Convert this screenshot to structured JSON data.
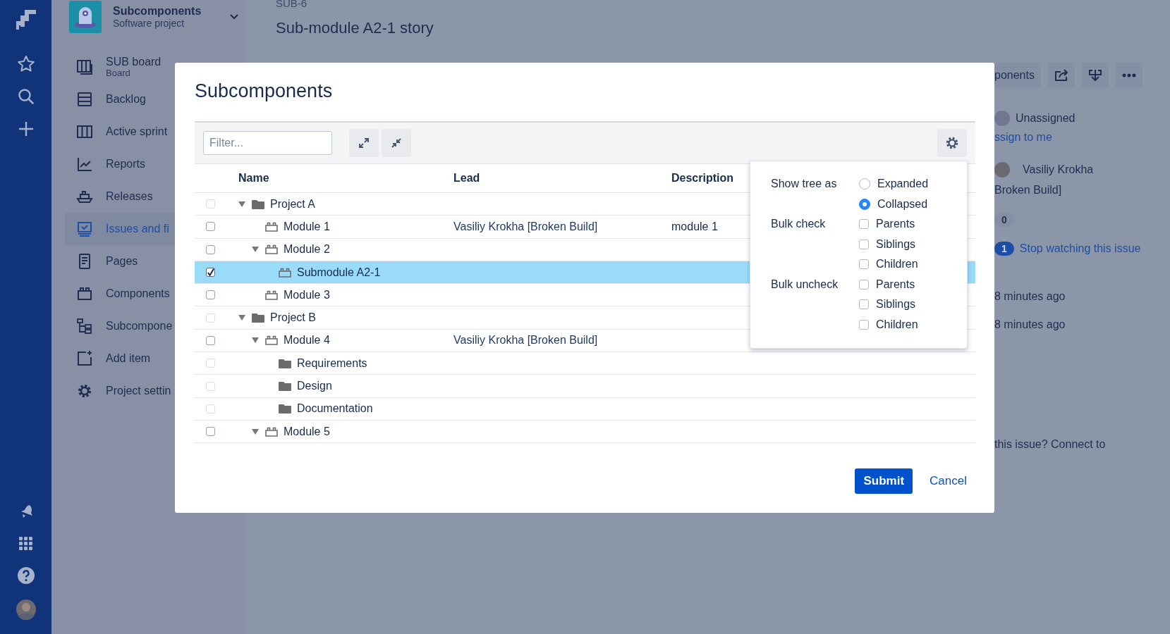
{
  "project": {
    "name": "Subcomponents",
    "type": "Software project"
  },
  "sidebar": {
    "items": [
      {
        "label": "SUB board",
        "sublabel": "Board",
        "kind": "board",
        "selected": false
      },
      {
        "label": "Backlog",
        "kind": "backlog",
        "selected": false
      },
      {
        "label": "Active sprint",
        "kind": "sprints",
        "selected": false
      },
      {
        "label": "Reports",
        "kind": "reports",
        "selected": false
      },
      {
        "label": "Releases",
        "kind": "releases",
        "selected": false
      },
      {
        "label": "Issues and fi",
        "kind": "issues",
        "selected": true
      },
      {
        "label": "Pages",
        "kind": "pages",
        "selected": false
      },
      {
        "label": "Components",
        "kind": "components",
        "selected": false
      },
      {
        "label": "Subcompone",
        "kind": "subcomponents",
        "selected": false
      },
      {
        "label": "Add item",
        "kind": "add",
        "selected": false
      },
      {
        "label": "Project settin",
        "kind": "settings",
        "selected": false
      }
    ]
  },
  "issue": {
    "key": "SUB-6",
    "title": "Sub-module A2-1 story"
  },
  "side_panel": {
    "toolbar_label": "ponents",
    "assignee": "Unassigned",
    "assign_link": "ssign to me",
    "reporter": "Vasiliy Krokha",
    "reporter_note": "Broken Build]",
    "votes": "0",
    "watchers": "1",
    "watch_link": "Stop watching this issue",
    "created": "8 minutes ago",
    "updated": "8 minutes ago",
    "connect_text": "this issue? Connect to"
  },
  "dialog": {
    "title": "Subcomponents",
    "filter": {
      "placeholder": "Filter..."
    },
    "columns": [
      "Name",
      "Lead",
      "Description"
    ],
    "rows": [
      {
        "name": "Project A",
        "kind": "folder",
        "disabled": true,
        "checked": false,
        "selected": false,
        "expanded": true,
        "children": [
          {
            "name": "Module 1",
            "kind": "component",
            "disabled": false,
            "checked": false,
            "selected": false,
            "lead": "Vasiliy Krokha [Broken Build]",
            "description": "module 1"
          },
          {
            "name": "Module 2",
            "kind": "component",
            "disabled": false,
            "checked": false,
            "selected": false,
            "expanded": true,
            "children": [
              {
                "name": "Submodule A2-1",
                "kind": "component",
                "disabled": false,
                "checked": true,
                "selected": true
              }
            ]
          },
          {
            "name": "Module 3",
            "kind": "component",
            "disabled": false,
            "checked": false,
            "selected": false
          }
        ]
      },
      {
        "name": "Project B",
        "kind": "folder",
        "disabled": true,
        "checked": false,
        "selected": false,
        "expanded": true,
        "children": [
          {
            "name": "Module 4",
            "kind": "component",
            "disabled": false,
            "checked": false,
            "selected": false,
            "lead": "Vasiliy Krokha [Broken Build]",
            "expanded": true,
            "children": [
              {
                "name": "Requirements",
                "kind": "folder",
                "disabled": true,
                "checked": false,
                "selected": false
              },
              {
                "name": "Design",
                "kind": "folder",
                "disabled": true,
                "checked": false,
                "selected": false
              },
              {
                "name": "Documentation",
                "kind": "folder",
                "disabled": true,
                "checked": false,
                "selected": false
              }
            ]
          },
          {
            "name": "Module 5",
            "kind": "component",
            "disabled": false,
            "checked": false,
            "selected": false,
            "expanded": true
          }
        ]
      }
    ],
    "settings": {
      "groups": [
        {
          "label": "Show tree as",
          "kind": "radio",
          "options": [
            {
              "label": "Expanded",
              "selected": false
            },
            {
              "label": "Collapsed",
              "selected": true
            }
          ]
        },
        {
          "label": "Bulk check",
          "kind": "checkbox",
          "options": [
            {
              "label": "Parents",
              "checked": false
            },
            {
              "label": "Siblings",
              "checked": false
            },
            {
              "label": "Children",
              "checked": false
            }
          ]
        },
        {
          "label": "Bulk uncheck",
          "kind": "checkbox",
          "options": [
            {
              "label": "Parents",
              "checked": false
            },
            {
              "label": "Siblings",
              "checked": false
            },
            {
              "label": "Children",
              "checked": false
            }
          ]
        }
      ]
    },
    "buttons": [
      {
        "label": "Submit",
        "kind": "primary"
      },
      {
        "label": "Cancel",
        "kind": "link"
      }
    ]
  }
}
